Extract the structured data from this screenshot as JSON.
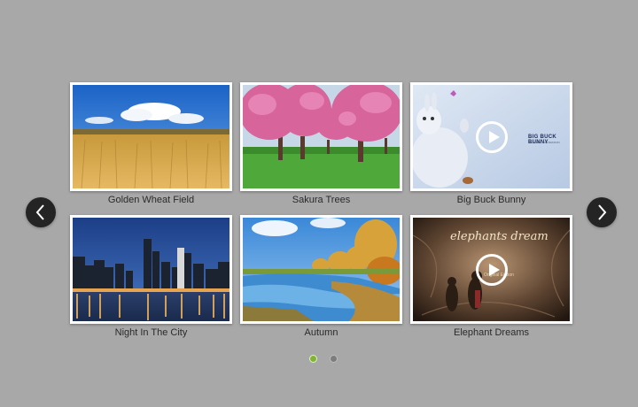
{
  "gallery": {
    "items": [
      {
        "caption": "Golden Wheat Field",
        "type": "image"
      },
      {
        "caption": "Sakura Trees",
        "type": "image"
      },
      {
        "caption": "Big Buck Bunny",
        "type": "video",
        "overlay_title": "BIG BUCK BUNNY",
        "overlay_sub": "BLENDER FOUNDATION"
      },
      {
        "caption": "Night In The City",
        "type": "image"
      },
      {
        "caption": "Autumn",
        "type": "image"
      },
      {
        "caption": "Elephant Dreams",
        "type": "video",
        "overlay_title": "elephants dream",
        "overlay_sub": "Original Edition"
      }
    ]
  },
  "navigation": {
    "prev_icon": "chevron-left-icon",
    "next_icon": "chevron-right-icon"
  },
  "pagination": {
    "current_page": 1,
    "total_pages": 2
  },
  "colors": {
    "background": "#a8a8a8",
    "active_dot": "#7fb533",
    "inactive_dot": "#7d7d7d",
    "nav_button": "#242424"
  }
}
